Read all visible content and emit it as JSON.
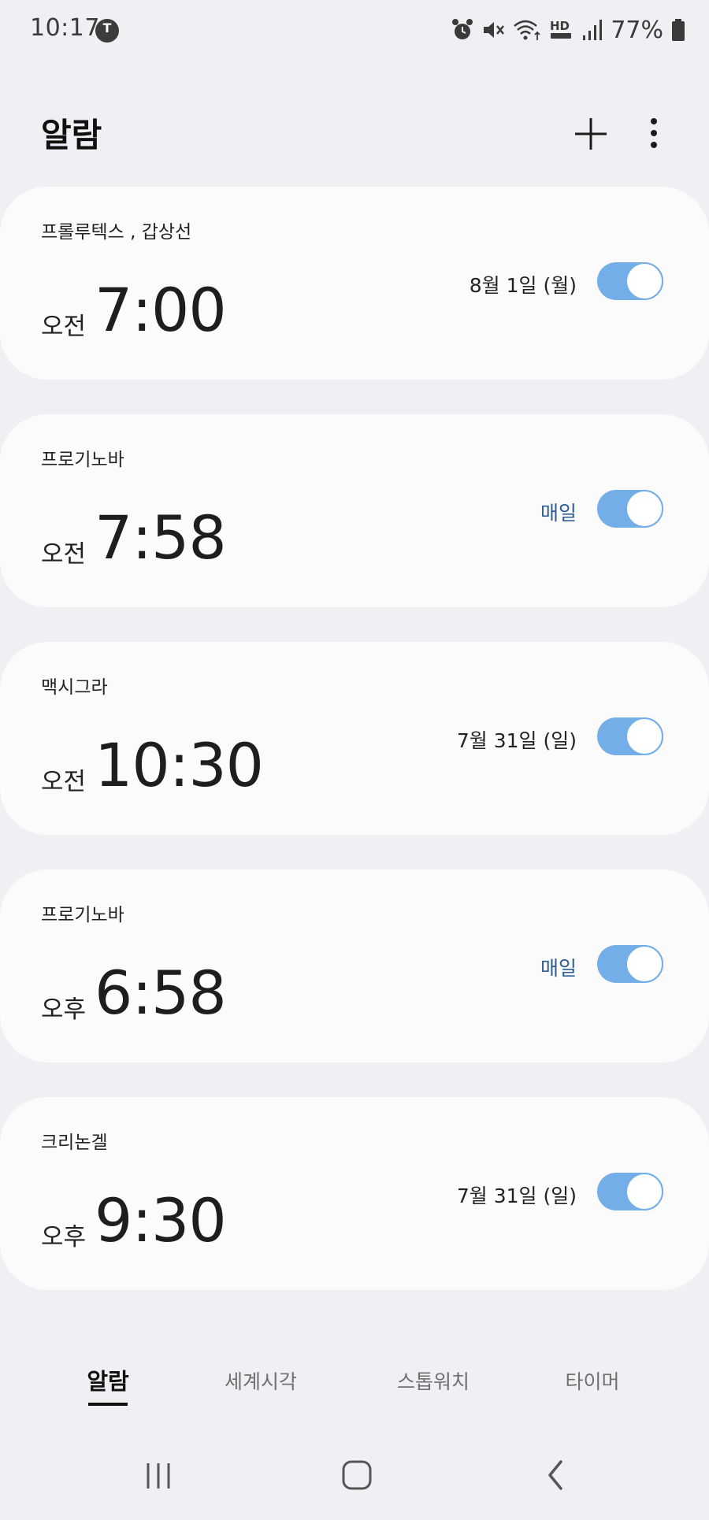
{
  "status_bar": {
    "time": "10:17",
    "carrier_icon": "tfree-icon",
    "carrier_icon_text": "T",
    "icons": [
      "alarm-icon",
      "mute-icon",
      "wifi-icon",
      "hd-voice-icon",
      "signal-icon",
      "battery-icon"
    ],
    "battery_text": "77%"
  },
  "header": {
    "title": "알람",
    "add_icon": "plus-icon",
    "more_icon": "more-vertical-icon"
  },
  "alarms": [
    {
      "label": "프롤루텍스 , 갑상선",
      "ampm": "오전",
      "time": "7:00",
      "when": "8월 1일 (월)",
      "daily": false,
      "enabled": true
    },
    {
      "label": "프로기노바",
      "ampm": "오전",
      "time": "7:58",
      "when": "매일",
      "daily": true,
      "enabled": true
    },
    {
      "label": "맥시그라",
      "ampm": "오전",
      "time": "10:30",
      "when": "7월 31일 (일)",
      "daily": false,
      "enabled": true
    },
    {
      "label": "프로기노바",
      "ampm": "오후",
      "time": "6:58",
      "when": "매일",
      "daily": true,
      "enabled": true
    },
    {
      "label": "크리논겔",
      "ampm": "오후",
      "time": "9:30",
      "when": "7월 31일 (일)",
      "daily": false,
      "enabled": true
    }
  ],
  "tabs": [
    {
      "label": "알람",
      "active": true
    },
    {
      "label": "세계시각",
      "active": false
    },
    {
      "label": "스톱워치",
      "active": false
    },
    {
      "label": "타이머",
      "active": false
    }
  ],
  "nav": {
    "recents_icon": "recents-icon",
    "home_icon": "home-icon",
    "back_icon": "back-icon"
  },
  "colors": {
    "background": "#eff0f4",
    "card": "#fbfbfb",
    "toggle_on": "#73aee9",
    "daily_text": "#2d5d96"
  }
}
